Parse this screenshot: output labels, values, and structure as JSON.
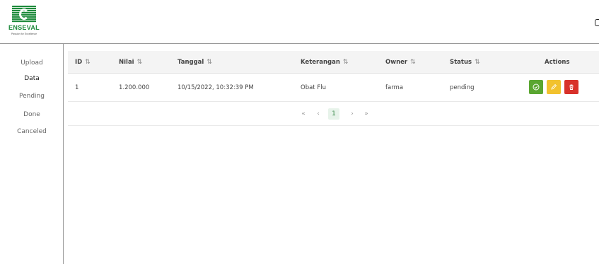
{
  "brand": {
    "name": "ENSEVAL",
    "tagline": "Passion for Excellence"
  },
  "sidebar": {
    "items": [
      {
        "label": "Upload"
      },
      {
        "label": "Data"
      },
      {
        "label": "Pending"
      },
      {
        "label": "Done"
      },
      {
        "label": "Canceled"
      }
    ],
    "active": "Data"
  },
  "table": {
    "columns": [
      "ID",
      "Nilai",
      "Tanggal",
      "Keterangan",
      "Owner",
      "Status",
      "Actions"
    ],
    "sort_icon": "⇅",
    "rows": [
      {
        "id": "1",
        "nilai": "1.200.000",
        "tanggal": "10/15/2022, 10:32:39 PM",
        "keterangan": "Obat Flu",
        "owner": "farma",
        "status": "pending",
        "actions": [
          "approve-icon",
          "edit-icon",
          "delete-icon"
        ]
      }
    ]
  },
  "pagination": {
    "first": "«",
    "prev": "‹",
    "current": "1",
    "next": "›",
    "last": "»"
  },
  "colors": {
    "approve": "#5aa631",
    "edit": "#f2c22e",
    "delete": "#d8312a",
    "brand_green": "#1e8a3c"
  }
}
